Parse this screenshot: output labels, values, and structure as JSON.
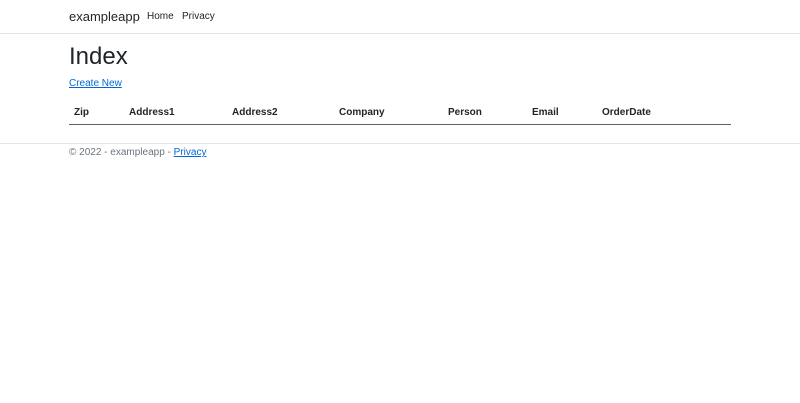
{
  "navbar": {
    "brand": "exampleapp",
    "links": [
      {
        "label": "Home"
      },
      {
        "label": "Privacy"
      }
    ]
  },
  "main": {
    "title": "Index",
    "create_link": "Create New",
    "table": {
      "headers": [
        "Zip",
        "Address1",
        "Address2",
        "Company",
        "Person",
        "Email",
        "OrderDate"
      ],
      "rows": []
    }
  },
  "footer": {
    "prefix": "© 2022 - exampleapp - ",
    "link": "Privacy"
  },
  "colors": {
    "link": "#0366d6",
    "text": "#212529",
    "muted": "#6c757d",
    "border": "#e5e5e5"
  }
}
